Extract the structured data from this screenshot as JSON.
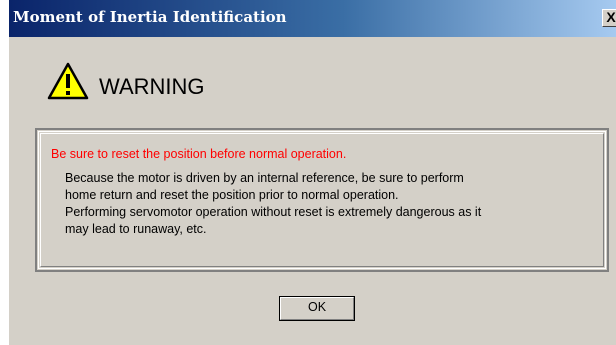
{
  "dialog": {
    "title": "Moment of Inertia Identification",
    "close_label": "X"
  },
  "warning": {
    "icon": "warning-triangle-icon",
    "label": "WARNING"
  },
  "message": {
    "alert": "Be sure to reset the position before normal operation.",
    "lines": [
      "Because the motor is driven by an internal  reference, be sure to perform",
      "home return and reset the position prior to normal operation.",
      "Performing servomotor operation without reset is extremely dangerous as it",
      "may lead to runaway, etc."
    ]
  },
  "buttons": {
    "ok_label": "OK"
  },
  "colors": {
    "dialog_bg": "#d4d0c8",
    "title_bar_start": "#0a246a",
    "title_bar_end": "#a6caf0",
    "alert_text": "#ff0000",
    "warning_fill": "#ffff00"
  }
}
